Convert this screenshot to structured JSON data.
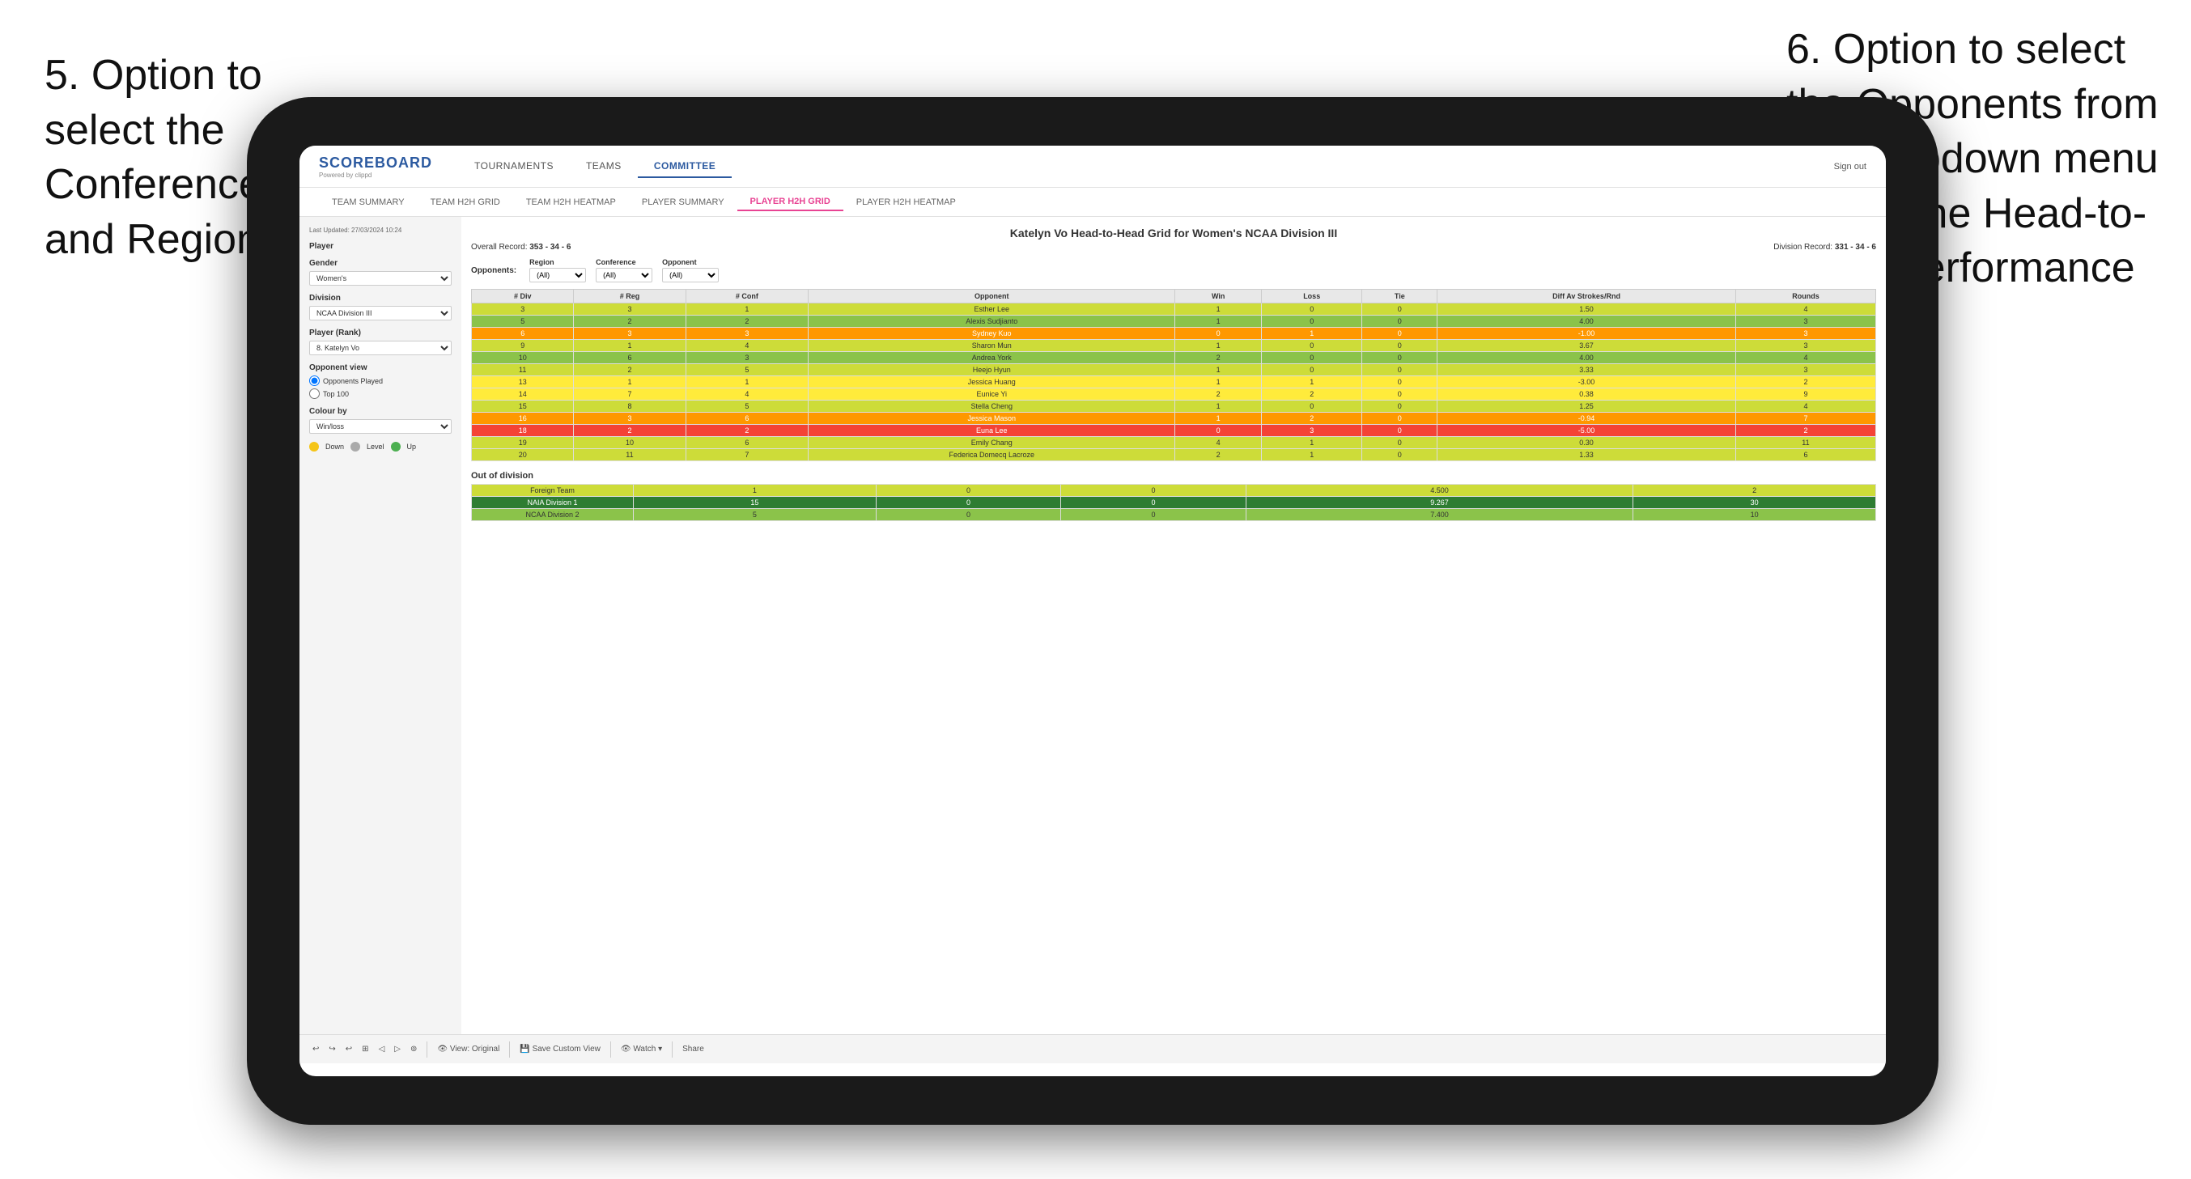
{
  "annotations": {
    "left": {
      "text": "5. Option to select the Conference and Region"
    },
    "right": {
      "text": "6. Option to select the Opponents from the dropdown menu to see the Head-to-Head performance"
    }
  },
  "app": {
    "logo": "SCOREBOARD",
    "logo_sub": "Powered by clippd",
    "nav_main": [
      {
        "label": "TOURNAMENTS",
        "active": false
      },
      {
        "label": "TEAMS",
        "active": false
      },
      {
        "label": "COMMITTEE",
        "active": true
      }
    ],
    "header_right": {
      "separator": "|",
      "sign_out": "Sign out"
    },
    "nav_sub": [
      {
        "label": "TEAM SUMMARY",
        "active": false
      },
      {
        "label": "TEAM H2H GRID",
        "active": false
      },
      {
        "label": "TEAM H2H HEATMAP",
        "active": false
      },
      {
        "label": "PLAYER SUMMARY",
        "active": false
      },
      {
        "label": "PLAYER H2H GRID",
        "active": true
      },
      {
        "label": "PLAYER H2H HEATMAP",
        "active": false
      }
    ]
  },
  "sidebar": {
    "timestamp": "Last Updated: 27/03/2024 10:24",
    "player_label": "Player",
    "gender_label": "Gender",
    "gender_value": "Women's",
    "division_label": "Division",
    "division_value": "NCAA Division III",
    "player_rank_label": "Player (Rank)",
    "player_rank_value": "8. Katelyn Vo",
    "opponent_view_label": "Opponent view",
    "opponent_view_options": [
      "Opponents Played",
      "Top 100"
    ],
    "colour_by_label": "Colour by",
    "colour_by_value": "Win/loss",
    "legend": [
      {
        "color": "#f5c518",
        "label": "Down"
      },
      {
        "color": "#aaa",
        "label": "Level"
      },
      {
        "color": "#4caf50",
        "label": "Up"
      }
    ]
  },
  "report": {
    "title": "Katelyn Vo Head-to-Head Grid for Women's NCAA Division III",
    "overall_record_label": "Overall Record:",
    "overall_record_value": "353 - 34 - 6",
    "division_record_label": "Division Record:",
    "division_record_value": "331 - 34 - 6",
    "filter_groups": [
      {
        "label": "Region",
        "placeholder": "(All)"
      },
      {
        "label": "Conference",
        "placeholder": "(All)"
      },
      {
        "label": "Opponent",
        "placeholder": "(All)"
      }
    ],
    "opponents_label": "Opponents:",
    "table_headers": [
      "# Div",
      "# Reg",
      "# Conf",
      "Opponent",
      "Win",
      "Loss",
      "Tie",
      "Diff Av Strokes/Rnd",
      "Rounds"
    ],
    "table_rows": [
      {
        "div": "3",
        "reg": "3",
        "conf": "1",
        "opponent": "Esther Lee",
        "win": "1",
        "loss": "0",
        "tie": "0",
        "diff": "1.50",
        "rounds": "4",
        "color": "green-light"
      },
      {
        "div": "5",
        "reg": "2",
        "conf": "2",
        "opponent": "Alexis Sudjianto",
        "win": "1",
        "loss": "0",
        "tie": "0",
        "diff": "4.00",
        "rounds": "3",
        "color": "green"
      },
      {
        "div": "6",
        "reg": "3",
        "conf": "3",
        "opponent": "Sydney Kuo",
        "win": "0",
        "loss": "1",
        "tie": "0",
        "diff": "-1.00",
        "rounds": "3",
        "color": "red-light"
      },
      {
        "div": "9",
        "reg": "1",
        "conf": "4",
        "opponent": "Sharon Mun",
        "win": "1",
        "loss": "0",
        "tie": "0",
        "diff": "3.67",
        "rounds": "3",
        "color": "green-light"
      },
      {
        "div": "10",
        "reg": "6",
        "conf": "3",
        "opponent": "Andrea York",
        "win": "2",
        "loss": "0",
        "tie": "0",
        "diff": "4.00",
        "rounds": "4",
        "color": "green"
      },
      {
        "div": "11",
        "reg": "2",
        "conf": "5",
        "opponent": "Heejo Hyun",
        "win": "1",
        "loss": "0",
        "tie": "0",
        "diff": "3.33",
        "rounds": "3",
        "color": "green-light"
      },
      {
        "div": "13",
        "reg": "1",
        "conf": "1",
        "opponent": "Jessica Huang",
        "win": "1",
        "loss": "1",
        "tie": "0",
        "diff": "-3.00",
        "rounds": "2",
        "color": "yellow"
      },
      {
        "div": "14",
        "reg": "7",
        "conf": "4",
        "opponent": "Eunice Yi",
        "win": "2",
        "loss": "2",
        "tie": "0",
        "diff": "0.38",
        "rounds": "9",
        "color": "yellow"
      },
      {
        "div": "15",
        "reg": "8",
        "conf": "5",
        "opponent": "Stella Cheng",
        "win": "1",
        "loss": "0",
        "tie": "0",
        "diff": "1.25",
        "rounds": "4",
        "color": "green-light"
      },
      {
        "div": "16",
        "reg": "3",
        "conf": "6",
        "opponent": "Jessica Mason",
        "win": "1",
        "loss": "2",
        "tie": "0",
        "diff": "-0.94",
        "rounds": "7",
        "color": "red-light"
      },
      {
        "div": "18",
        "reg": "2",
        "conf": "2",
        "opponent": "Euna Lee",
        "win": "0",
        "loss": "3",
        "tie": "0",
        "diff": "-5.00",
        "rounds": "2",
        "color": "red"
      },
      {
        "div": "19",
        "reg": "10",
        "conf": "6",
        "opponent": "Emily Chang",
        "win": "4",
        "loss": "1",
        "tie": "0",
        "diff": "0.30",
        "rounds": "11",
        "color": "green-light"
      },
      {
        "div": "20",
        "reg": "11",
        "conf": "7",
        "opponent": "Federica Domecq Lacroze",
        "win": "2",
        "loss": "1",
        "tie": "0",
        "diff": "1.33",
        "rounds": "6",
        "color": "green-light"
      }
    ],
    "out_of_division_title": "Out of division",
    "out_of_division_rows": [
      {
        "opponent": "Foreign Team",
        "win": "1",
        "loss": "0",
        "tie": "0",
        "diff": "4.500",
        "rounds": "2",
        "color": "green-light"
      },
      {
        "opponent": "NAIA Division 1",
        "win": "15",
        "loss": "0",
        "tie": "0",
        "diff": "9.267",
        "rounds": "30",
        "color": "green-dark"
      },
      {
        "opponent": "NCAA Division 2",
        "win": "5",
        "loss": "0",
        "tie": "0",
        "diff": "7.400",
        "rounds": "10",
        "color": "green"
      }
    ]
  },
  "toolbar": {
    "buttons": [
      "↩",
      "↩",
      "↩",
      "⊞",
      "◁",
      "▷",
      "⊚",
      "|",
      "👁 View: Original",
      "|",
      "💾 Save Custom View",
      "|",
      "👁 Watch ▾",
      "|",
      "⬆",
      "⇄",
      "Share"
    ]
  }
}
